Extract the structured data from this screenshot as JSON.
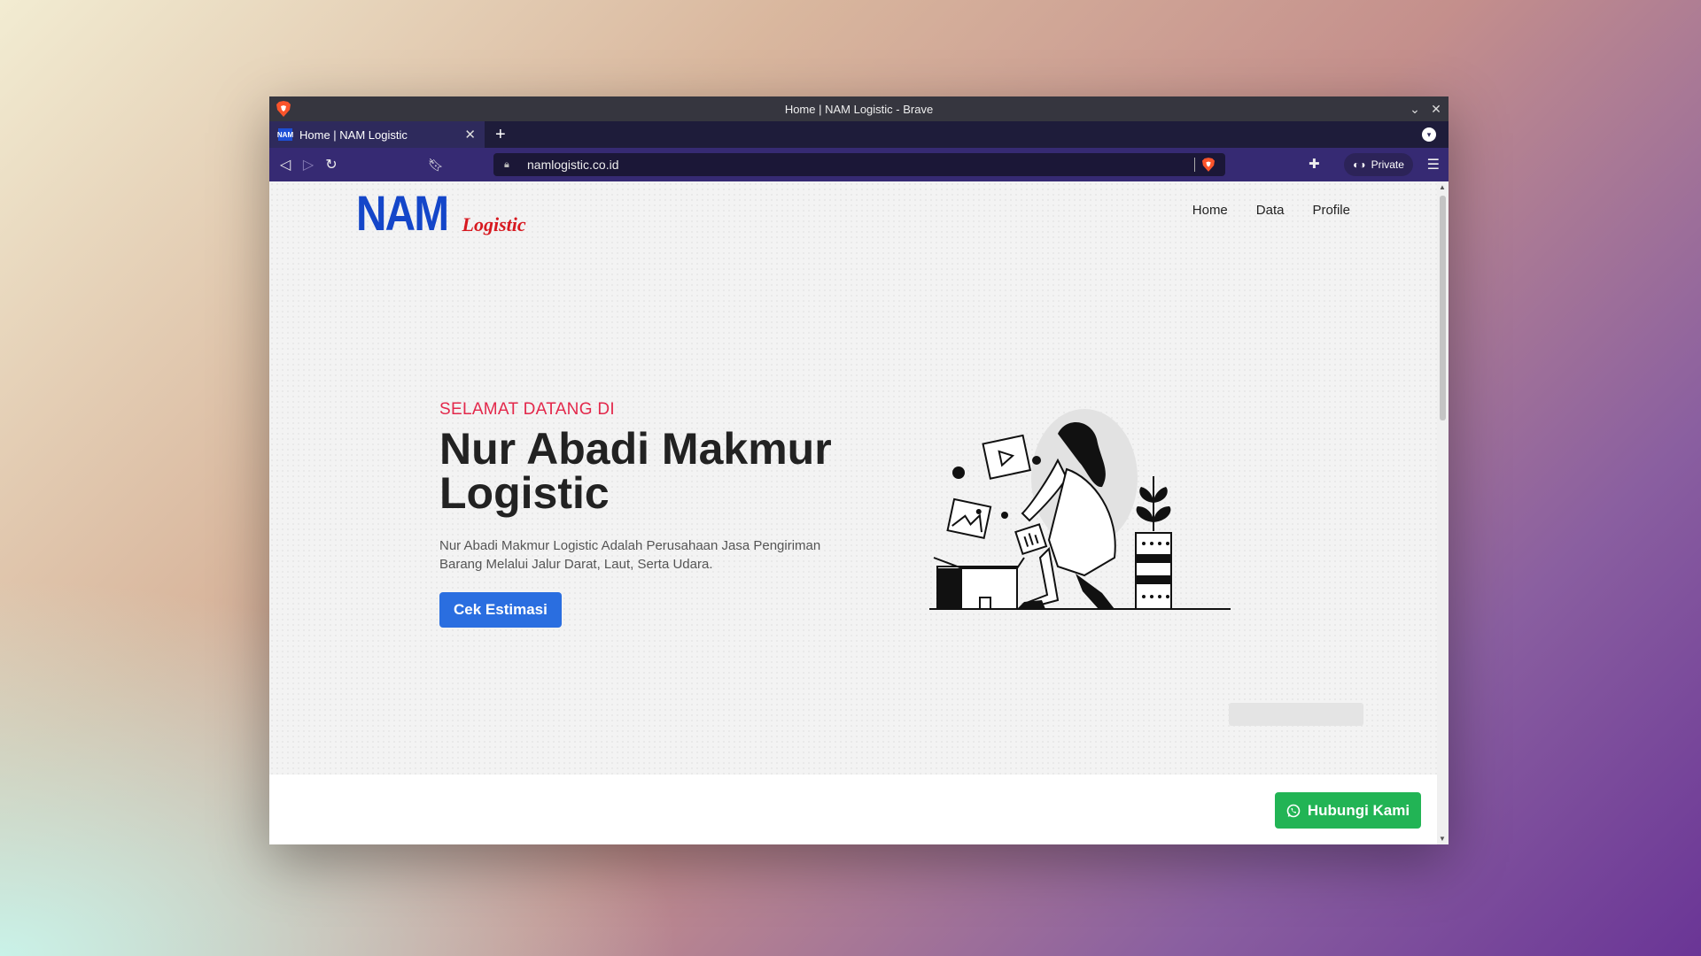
{
  "window": {
    "title": "Home | NAM Logistic - Brave"
  },
  "tabs": [
    {
      "label": "Home | NAM Logistic",
      "favicon_text": "NAM"
    }
  ],
  "toolbar": {
    "url": "namlogistic.co.id",
    "private_label": "Private"
  },
  "site": {
    "logo_primary": "NAM",
    "logo_secondary": "Logistic",
    "nav": [
      "Home",
      "Data",
      "Profile"
    ],
    "hero": {
      "greeting": "SELAMAT DATANG DI",
      "headline_line1": "Nur Abadi Makmur",
      "headline_line2": "Logistic",
      "description": "Nur Abadi Makmur Logistic Adalah Perusahaan Jasa Pengiriman Barang Melalui Jalur Darat, Laut, Serta Udara.",
      "cta_label": "Cek Estimasi"
    },
    "contact_button": "Hubungi Kami"
  },
  "colors": {
    "brand_blue": "#1446c9",
    "brand_red": "#d71920",
    "cta_blue": "#2a6ee0",
    "whatsapp_green": "#22b455",
    "greeting_red": "#e3284b"
  },
  "icons": {
    "browser": "brave-lion-icon",
    "lock": "lock-icon",
    "shield": "brave-shields-icon",
    "extensions": "puzzle-icon",
    "private": "private-glasses-icon",
    "menu": "hamburger-icon",
    "whatsapp": "whatsapp-icon"
  }
}
